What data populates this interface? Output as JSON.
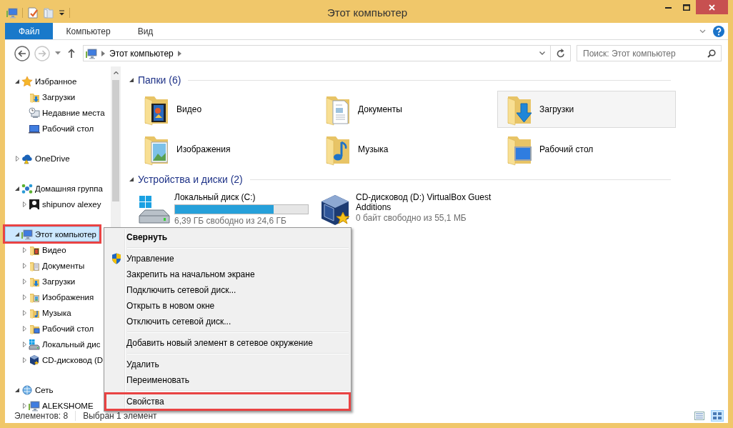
{
  "window": {
    "title": "Этот компьютер"
  },
  "ribbon": {
    "tabs": [
      {
        "label": "Файл",
        "kind": "file"
      },
      {
        "label": "Компьютер",
        "kind": "tab"
      },
      {
        "label": "Вид",
        "kind": "tab"
      }
    ]
  },
  "address": {
    "path": [
      "Этот компьютер"
    ]
  },
  "search": {
    "placeholder": "Поиск: Этот компьютер"
  },
  "navigation": {
    "items": [
      {
        "label": "Избранное",
        "kind": "star",
        "expanded": true,
        "selected": false,
        "highlighted": false,
        "children": [
          {
            "label": "Загрузки",
            "kind": "downloads",
            "selected": false,
            "highlighted": false
          },
          {
            "label": "Недавние места",
            "kind": "recent",
            "selected": false,
            "highlighted": false
          },
          {
            "label": "Рабочий стол",
            "kind": "desktop",
            "selected": false,
            "highlighted": false
          }
        ]
      },
      {
        "label": "OneDrive",
        "kind": "cloud",
        "expanded": false,
        "selected": false,
        "highlighted": false
      },
      {
        "label": "Домашняя группа",
        "kind": "homegroup",
        "expanded": true,
        "selected": false,
        "highlighted": false,
        "children": [
          {
            "label": "shipunov alexey",
            "kind": "user",
            "expanded": false,
            "selected": false,
            "highlighted": false
          }
        ]
      },
      {
        "label": "Этот компьютер",
        "kind": "computer",
        "expanded": true,
        "selected": true,
        "highlighted": true,
        "children": [
          {
            "label": "Видео",
            "kind": "video",
            "expanded": false,
            "selected": false,
            "highlighted": false
          },
          {
            "label": "Документы",
            "kind": "documents",
            "expanded": false,
            "selected": false,
            "highlighted": false
          },
          {
            "label": "Загрузки",
            "kind": "downloads",
            "expanded": false,
            "selected": false,
            "highlighted": false
          },
          {
            "label": "Изображения",
            "kind": "pictures",
            "expanded": false,
            "selected": false,
            "highlighted": false
          },
          {
            "label": "Музыка",
            "kind": "music",
            "expanded": false,
            "selected": false,
            "highlighted": false
          },
          {
            "label": "Рабочий стол",
            "kind": "desktop-folder",
            "expanded": false,
            "selected": false,
            "highlighted": false
          },
          {
            "label": "Локальный дис",
            "kind": "hdd",
            "expanded": false,
            "selected": false,
            "highlighted": false
          },
          {
            "label": "CD-дисковод (D",
            "kind": "cd",
            "expanded": false,
            "selected": false,
            "highlighted": false
          }
        ]
      },
      {
        "label": "Сеть",
        "kind": "network",
        "expanded": true,
        "selected": false,
        "highlighted": false,
        "children": [
          {
            "label": "ALEKSHOME",
            "kind": "pc",
            "expanded": false,
            "selected": false,
            "highlighted": false
          }
        ]
      }
    ]
  },
  "content": {
    "sections": [
      {
        "title": "Папки (6)",
        "kind": "folders",
        "expanded": true,
        "items": [
          {
            "name": "Видео",
            "kind": "video",
            "selected": false
          },
          {
            "name": "Документы",
            "kind": "documents",
            "selected": false
          },
          {
            "name": "Загрузки",
            "kind": "downloads",
            "selected": true
          },
          {
            "name": "Изображения",
            "kind": "pictures",
            "selected": false
          },
          {
            "name": "Музыка",
            "kind": "music",
            "selected": false
          },
          {
            "name": "Рабочий стол",
            "kind": "desktop-folder",
            "selected": false
          }
        ]
      },
      {
        "title": "Устройства и диски (2)",
        "kind": "drives",
        "expanded": true,
        "items": [
          {
            "name": "Локальный диск (C:)",
            "kind": "hdd",
            "level": 0.74,
            "free": "6,39 ГБ свободно из 24,6 ГБ",
            "selected": false
          },
          {
            "name": "CD-дисковод (D:) VirtualBox Guest Additions",
            "kind": "cd",
            "free": "0 байт свободно из 55,1 МБ",
            "selected": false
          }
        ]
      }
    ]
  },
  "context_menu": {
    "items": [
      {
        "label": "Свернуть",
        "kind": "default",
        "highlighted": false
      },
      {
        "kind": "separator"
      },
      {
        "label": "Управление",
        "kind": "admin",
        "highlighted": false
      },
      {
        "label": "Закрепить на начальном экране",
        "kind": "item",
        "highlighted": false
      },
      {
        "label": "Подключить сетевой диск...",
        "kind": "item",
        "highlighted": false
      },
      {
        "label": "Открыть в новом окне",
        "kind": "item",
        "highlighted": false
      },
      {
        "label": "Отключить сетевой диск...",
        "kind": "item",
        "highlighted": false
      },
      {
        "kind": "separator"
      },
      {
        "label": "Добавить новый элемент в сетевое окружение",
        "kind": "item",
        "highlighted": false
      },
      {
        "kind": "separator"
      },
      {
        "label": "Удалить",
        "kind": "item",
        "highlighted": false
      },
      {
        "label": "Переименовать",
        "kind": "item",
        "highlighted": false
      },
      {
        "kind": "separator"
      },
      {
        "label": "Свойства",
        "kind": "item",
        "highlighted": true
      }
    ]
  },
  "status_bar": {
    "item_count": "Элементов: 8",
    "selection": "Выбран 1 элемент"
  }
}
